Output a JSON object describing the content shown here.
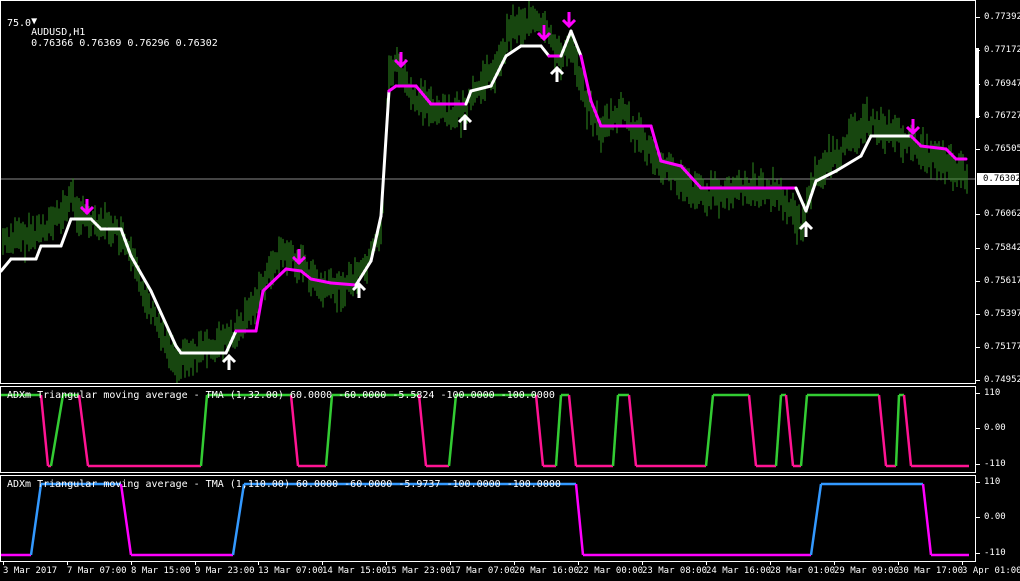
{
  "chart_title": {
    "symbol": "AUDUSD,H1",
    "ohlc": "0.76366 0.76369 0.76296 0.76302",
    "sub": "75.0"
  },
  "price_scale": [
    "0.77392",
    "0.77172",
    "0.76947",
    "0.76727",
    "0.76505",
    "0.76302",
    "0.76062",
    "0.75842",
    "0.75617",
    "0.75397",
    "0.75177",
    "0.74952"
  ],
  "current_price": "0.76302",
  "indicator1": {
    "label": "ADXm Triangular moving average - TMA (1,32.00) 60.0000 -60.0000 -5.5824 -100.0000 -100.0000",
    "scale": [
      "110",
      "0.00",
      "-110"
    ]
  },
  "indicator2": {
    "label": "ADXm Triangular moving average - TMA (1,110.00) 60.0000 -60.0000 -5.9737 -100.0000 -100.0000",
    "scale": [
      "110",
      "0.00",
      "-110"
    ]
  },
  "time_axis": [
    "3 Mar 2017",
    "7 Mar 07:00",
    "8 Mar 15:00",
    "9 Mar 23:00",
    "13 Mar 07:00",
    "14 Mar 15:00",
    "15 Mar 23:00",
    "17 Mar 07:00",
    "20 Mar 16:00",
    "22 Mar 00:00",
    "23 Mar 08:00",
    "24 Mar 16:00",
    "28 Mar 01:00",
    "29 Mar 09:00",
    "30 Mar 17:00",
    "3 Apr 01:00"
  ],
  "colors": {
    "bars": "#2e8b1e",
    "tma_up": "#ffffff",
    "tma_down": "#ff00ff",
    "ind_up": "#33cc33",
    "ind_down": "#ff1493",
    "ind2_up": "#3399ff",
    "ind2_down": "#ff00ff",
    "arrow_up": "#ffffff",
    "arrow_down": "#ff00ff"
  }
}
